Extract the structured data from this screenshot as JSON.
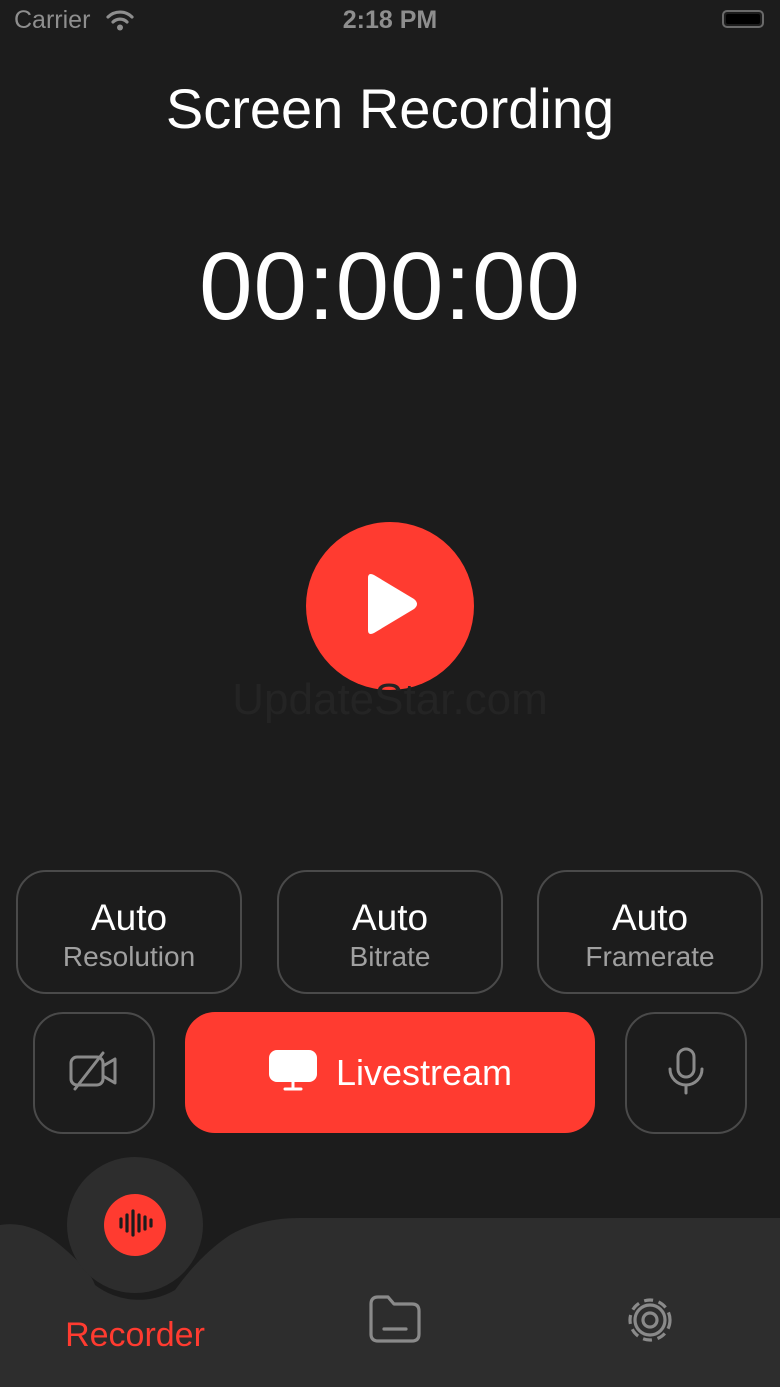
{
  "status_bar": {
    "carrier": "Carrier",
    "time": "2:18 PM"
  },
  "header": {
    "title": "Screen Recording"
  },
  "timer": {
    "value": "00:00:00"
  },
  "watermark": "UpdateStar.com",
  "options": [
    {
      "value": "Auto",
      "label": "Resolution"
    },
    {
      "value": "Auto",
      "label": "Bitrate"
    },
    {
      "value": "Auto",
      "label": "Framerate"
    }
  ],
  "actions": {
    "livestream_label": "Livestream"
  },
  "tabs": {
    "recorder_label": "Recorder"
  },
  "colors": {
    "accent": "#ff3b30",
    "background": "#1c1c1c",
    "tabbar": "#2d2d2d"
  },
  "icons": [
    "wifi-icon",
    "battery-icon",
    "play-icon",
    "camera-off-icon",
    "tv-icon",
    "microphone-icon",
    "waveform-icon",
    "folder-icon",
    "gear-icon"
  ]
}
